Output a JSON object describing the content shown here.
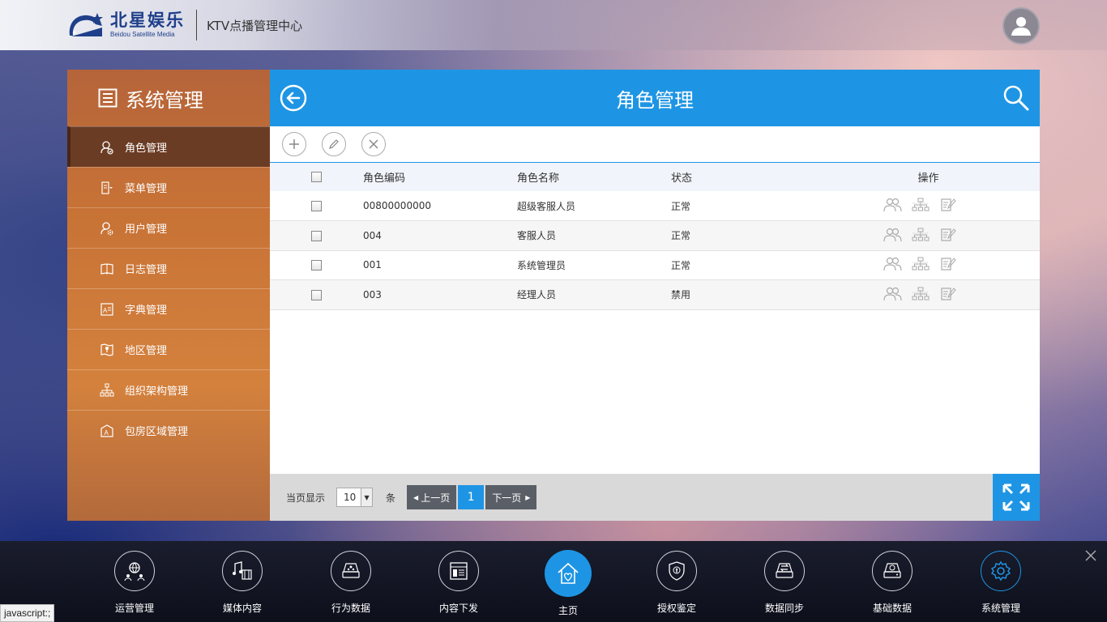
{
  "header": {
    "logo_cn": "北星娱乐",
    "logo_en": "Beidou Satellite Media",
    "app_title": "KTV点播管理中心"
  },
  "sidebar": {
    "title": "系统管理",
    "items": [
      {
        "label": "角色管理",
        "icon": "role-icon",
        "active": true
      },
      {
        "label": "菜单管理",
        "icon": "menu-icon"
      },
      {
        "label": "用户管理",
        "icon": "user-gear-icon"
      },
      {
        "label": "日志管理",
        "icon": "book-icon"
      },
      {
        "label": "字典管理",
        "icon": "dictionary-icon"
      },
      {
        "label": "地区管理",
        "icon": "map-icon"
      },
      {
        "label": "组织架构管理",
        "icon": "org-chart-icon"
      },
      {
        "label": "包房区域管理",
        "icon": "area-icon"
      }
    ]
  },
  "content": {
    "title": "角色管理",
    "toolbar": {
      "add": "add-icon",
      "edit": "pencil-icon",
      "delete": "close-icon"
    },
    "table": {
      "headers": {
        "code": "角色编码",
        "name": "角色名称",
        "status": "状态",
        "ops": "操作"
      },
      "rows": [
        {
          "code": "00800000000",
          "name": "超级客服人员",
          "status": "正常"
        },
        {
          "code": "004",
          "name": "客服人员",
          "status": "正常"
        },
        {
          "code": "001",
          "name": "系统管理员",
          "status": "正常"
        },
        {
          "code": "003",
          "name": "经理人员",
          "status": "禁用"
        }
      ]
    },
    "pager": {
      "show_label": "当页显示",
      "page_size": "10",
      "unit": "条",
      "prev": "上一页",
      "current": "1",
      "next": "下一页"
    }
  },
  "dock": {
    "items": [
      {
        "label": "运营管理",
        "icon": "globe-users-icon"
      },
      {
        "label": "媒体内容",
        "icon": "music-film-icon"
      },
      {
        "label": "行为数据",
        "icon": "drive-network-icon"
      },
      {
        "label": "内容下发",
        "icon": "layout-icon"
      },
      {
        "label": "主页",
        "icon": "home-icon"
      },
      {
        "label": "授权鉴定",
        "icon": "shield-icon"
      },
      {
        "label": "数据同步",
        "icon": "sync-drive-icon"
      },
      {
        "label": "基础数据",
        "icon": "hard-drive-icon"
      },
      {
        "label": "系统管理",
        "icon": "gear-icon"
      }
    ]
  },
  "statusbar": {
    "text": "javascript:;"
  },
  "colors": {
    "accent": "#1e95e4",
    "sidebar": "#c77236",
    "sidebar_active": "#6b3c24"
  }
}
